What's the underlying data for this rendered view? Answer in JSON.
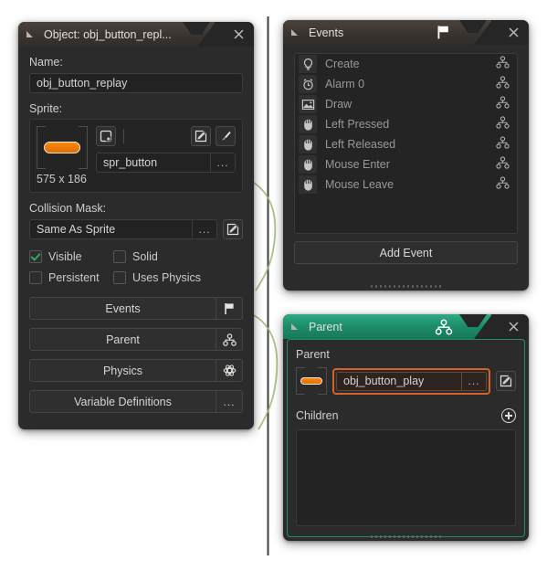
{
  "object_window": {
    "title": "Object: obj_button_repl...",
    "collapse_icon": "collapse-triangle-icon",
    "close_icon": "close-icon",
    "name_label": "Name:",
    "name_value": "obj_button_replay",
    "sprite_label": "Sprite:",
    "sprite_value": "spr_button",
    "sprite_dimensions": "575 x 186",
    "sprite_new_icon": "new-sprite-icon",
    "sprite_edit_icon": "edit-image-icon",
    "sprite_paint_icon": "paintbrush-icon",
    "sprite_menu_label": "...",
    "collision_label": "Collision Mask:",
    "collision_value": "Same As Sprite",
    "collision_menu_label": "...",
    "collision_edit_icon": "edit-image-icon",
    "checkboxes": [
      {
        "label": "Visible",
        "checked": true
      },
      {
        "label": "Solid",
        "checked": false
      },
      {
        "label": "Persistent",
        "checked": false
      },
      {
        "label": "Uses Physics",
        "checked": false
      }
    ],
    "buttons": [
      {
        "label": "Events",
        "icon": "flag-icon",
        "end_label": ""
      },
      {
        "label": "Parent",
        "icon": "parent-node-icon",
        "end_label": ""
      },
      {
        "label": "Physics",
        "icon": "physics-atom-icon",
        "end_label": ""
      },
      {
        "label": "Variable Definitions",
        "icon": "ellipsis-icon",
        "end_label": "..."
      }
    ]
  },
  "events_window": {
    "title": "Events",
    "header_icon": "flag-icon",
    "collapse_icon": "collapse-triangle-icon",
    "close_icon": "close-icon",
    "events": [
      {
        "name": "Create",
        "icon": "lightbulb-icon",
        "link_icon": "parent-node-icon"
      },
      {
        "name": "Alarm 0",
        "icon": "alarm-clock-icon",
        "link_icon": "parent-node-icon"
      },
      {
        "name": "Draw",
        "icon": "image-icon",
        "link_icon": "parent-node-icon"
      },
      {
        "name": "Left Pressed",
        "icon": "mouse-icon",
        "link_icon": "parent-node-icon"
      },
      {
        "name": "Left Released",
        "icon": "mouse-icon",
        "link_icon": "parent-node-icon"
      },
      {
        "name": "Mouse Enter",
        "icon": "mouse-icon",
        "link_icon": "parent-node-icon"
      },
      {
        "name": "Mouse Leave",
        "icon": "mouse-icon",
        "link_icon": "parent-node-icon"
      }
    ],
    "add_event_label": "Add Event"
  },
  "parent_window": {
    "title": "Parent",
    "header_icon": "parent-node-icon",
    "collapse_icon": "collapse-triangle-icon",
    "close_icon": "close-icon",
    "parent_label": "Parent",
    "parent_value": "obj_button_play",
    "parent_menu_label": "...",
    "parent_edit_icon": "edit-image-icon",
    "parent_thumb_icon": "sprite-thumbnail-icon",
    "children_label": "Children",
    "children_add_icon": "plus-circle-icon",
    "children_items": []
  },
  "colors": {
    "accent_orange": "#d4622a",
    "accent_teal": "#1f8f69",
    "tab_brown": "#4a423c",
    "connector_green": "#9db870",
    "check_green": "#2faa5f",
    "panel_bg": "#2b2b2b",
    "page_bg": "#ffffff"
  }
}
